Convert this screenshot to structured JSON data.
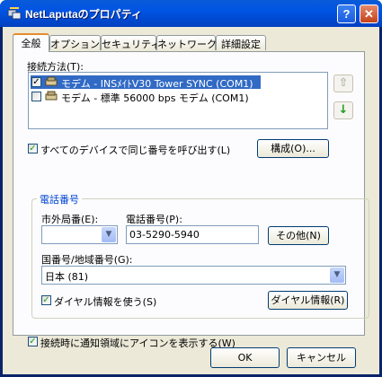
{
  "window": {
    "title": "NetLaputaのプロパティ",
    "help_glyph": "?",
    "close_glyph": "✕"
  },
  "tabs": [
    {
      "label": "全般"
    },
    {
      "label": "オプション"
    },
    {
      "label": "セキュリティ"
    },
    {
      "label": "ネットワーク"
    },
    {
      "label": "詳細設定"
    }
  ],
  "general": {
    "connect_using_label": "接続方法(T):",
    "devices": [
      {
        "label": "モデム - INSﾒｲﾄV30 Tower SYNC (COM1)",
        "checked": true,
        "selected": true
      },
      {
        "label": "モデム - 標準 56000 bps モデム (COM1)",
        "checked": false,
        "selected": false
      }
    ],
    "move_up_glyph": "⇧",
    "move_down_glyph": "↓",
    "same_number_label": "すべてのデバイスで同じ番号を呼び出す(L)",
    "same_number_checked": true,
    "configure_button": "構成(O)...",
    "phone_group_title": "電話番号",
    "area_code_label": "市外局番(E):",
    "area_code_value": "",
    "phone_number_label": "電話番号(P):",
    "phone_number_value": "03-5290-5940",
    "alternates_button": "その他(N)",
    "country_label": "国番号/地域番号(G):",
    "country_value": "日本 (81)",
    "dialing_rules_label": "ダイヤル情報を使う(S)",
    "dialing_rules_checked": true,
    "dialing_rules_button": "ダイヤル情報(R)",
    "show_icon_label": "接続時に通知領域にアイコンを表示する(W)",
    "show_icon_checked": true
  },
  "footer": {
    "ok_button": "OK",
    "cancel_button": "キャンセル"
  },
  "colors": {
    "titlebar": "#0054e3",
    "selection": "#316ac5",
    "tab_highlight": "#e68b2c",
    "group_title": "#0046d5"
  }
}
